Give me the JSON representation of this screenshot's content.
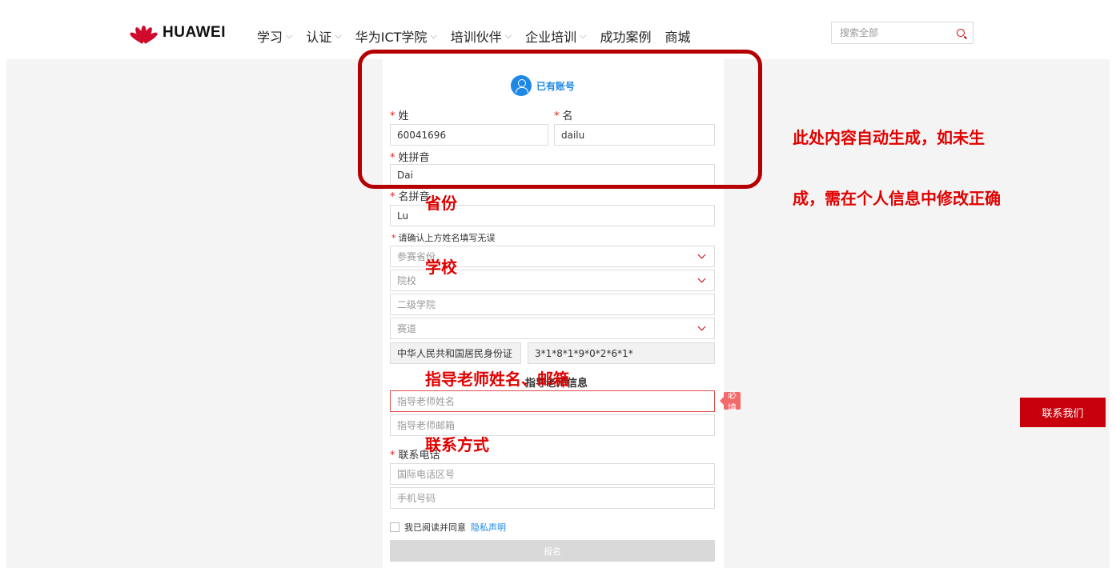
{
  "header": {
    "logo_text": "HUAWEI",
    "nav": [
      {
        "label": "学习",
        "has_dropdown": true
      },
      {
        "label": "认证",
        "has_dropdown": true
      },
      {
        "label": "华为ICT学院",
        "has_dropdown": true
      },
      {
        "label": "培训伙伴",
        "has_dropdown": true
      },
      {
        "label": "企业培训",
        "has_dropdown": true
      },
      {
        "label": "成功案例",
        "has_dropdown": false
      },
      {
        "label": "商城",
        "has_dropdown": false
      }
    ],
    "search_placeholder": "搜索全部"
  },
  "form": {
    "account_text": "已有账号",
    "surname_label": "姓",
    "surname_value": "60041696",
    "given_label": "名",
    "given_value": "dailu",
    "surname_pinyin_label": "姓拼音",
    "surname_pinyin_value": "Dai",
    "given_pinyin_label": "名拼音",
    "given_pinyin_value": "Lu",
    "confirm_note": "请确认上方姓名填写无误",
    "province_placeholder": "参赛省份",
    "school_placeholder": "院校",
    "college_placeholder": "二级学院",
    "track_placeholder": "赛道",
    "id_type": "中华人民共和国居民身份证",
    "id_number": "3*1*8*1*9*0*2*6*1*",
    "teacher_section_title": "指导老师信息",
    "teacher_name_placeholder": "指导老师姓名",
    "teacher_email_placeholder": "指导老师邮箱",
    "required_tag": "必填",
    "phone_label": "联系电话",
    "area_code_placeholder": "国际电话区号",
    "mobile_placeholder": "手机号码",
    "agree_text": "我已阅读并同意",
    "privacy_link": "隐私声明",
    "submit_label": "报名"
  },
  "annotations": {
    "auto_generated_line1": "此处内容自动生成，如未生",
    "auto_generated_line2": "成，需在个人信息中修改正确",
    "province": "省份",
    "school": "学校",
    "teacher": "指导老师姓名、邮箱",
    "contact": "联系方式"
  },
  "contact_button": "联系我们",
  "colors": {
    "brand_red": "#c7000b",
    "link_blue": "#1e88e5",
    "annotation_red": "#e00000"
  }
}
